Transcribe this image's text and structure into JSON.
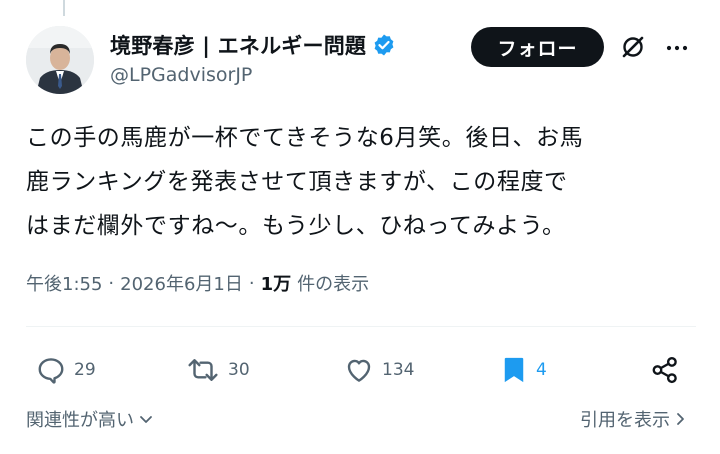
{
  "header": {
    "display_name": "境野春彦 | エネルギー問題",
    "handle": "@LPGadvisorJP",
    "follow_label": "フォロー"
  },
  "tweet": {
    "lines": [
      "この手の馬鹿が一杯でてきそうな6月笑。後日、お馬",
      "鹿ランキングを発表させて頂きますが、この程度で",
      "はまだ欄外ですね〜。もう少し、ひねってみよう。"
    ]
  },
  "meta": {
    "time": "午後1:55",
    "separator": "·",
    "date": "2026年6月1日",
    "views_count": "1万",
    "views_label": "件の表示"
  },
  "actions": {
    "replies": "29",
    "retweets": "30",
    "likes": "134",
    "bookmarks": "4"
  },
  "footer": {
    "sort_label": "関連性が高い",
    "quotes_label": "引用を表示"
  },
  "colors": {
    "accent": "#1d9bf0",
    "text": "#0f1419",
    "muted": "#536471",
    "verified": "#1d9bf0"
  }
}
